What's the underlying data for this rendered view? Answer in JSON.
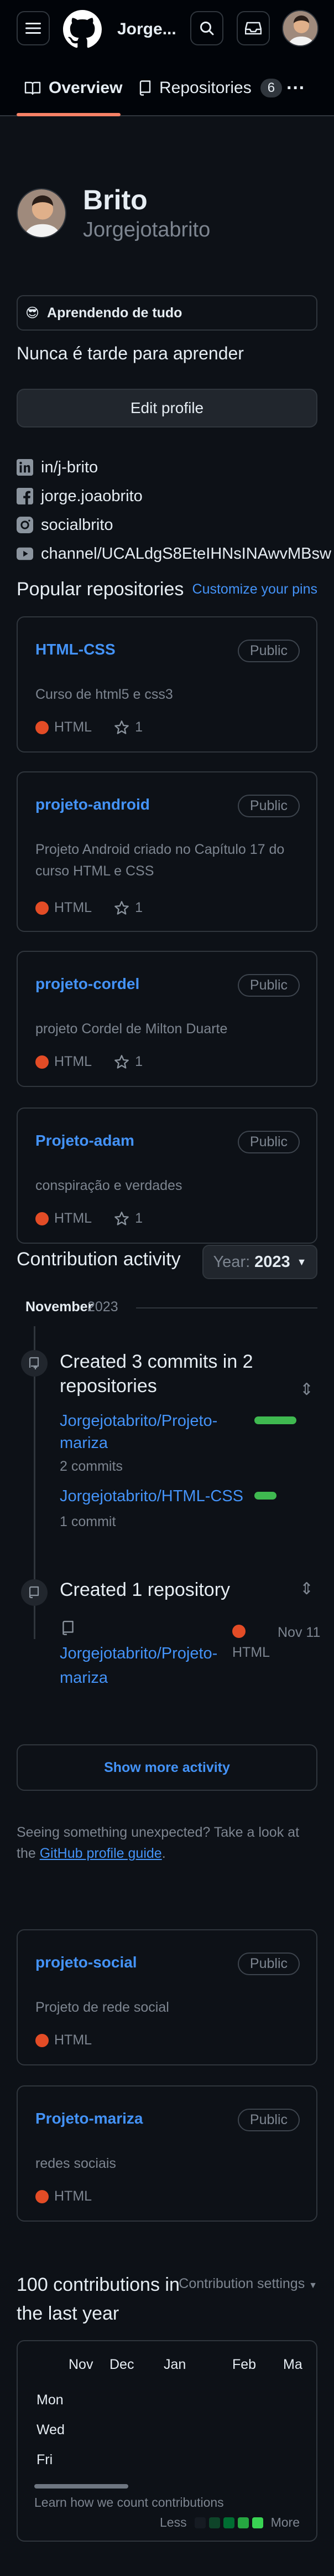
{
  "header": {
    "username": "Jorge...",
    "menu_icon": "hamburger-icon",
    "logo_icon": "github-logo",
    "search_icon": "search-icon",
    "inbox_icon": "inbox-icon"
  },
  "tabs": {
    "overview": "Overview",
    "repositories": "Repositories",
    "repo_count": "6",
    "more": "···"
  },
  "profile": {
    "name": "Brito",
    "login": "Jorgejotabrito",
    "status_emoji": "😎",
    "status_text": "Aprendendo de tudo",
    "bio": "Nunca é tarde para aprender",
    "edit_button": "Edit profile",
    "links": [
      {
        "icon": "linkedin-icon",
        "text": "in/j-brito"
      },
      {
        "icon": "facebook-icon",
        "text": "jorge.joaobrito"
      },
      {
        "icon": "instagram-icon",
        "text": "socialbrito"
      },
      {
        "icon": "youtube-icon",
        "text": "channel/UCALdgS8EteIHNsINAwvMBsw"
      }
    ]
  },
  "popular": {
    "title": "Popular repositories",
    "customize": "Customize your pins",
    "repos": [
      {
        "name": "HTML-CSS",
        "visibility": "Public",
        "description": "Curso de html5 e css3",
        "language": "HTML",
        "stars": "1"
      },
      {
        "name": "projeto-android",
        "visibility": "Public",
        "description": "Projeto Android criado no Capítulo 17 do curso HTML e CSS",
        "language": "HTML",
        "stars": "1"
      },
      {
        "name": "projeto-cordel",
        "visibility": "Public",
        "description": "projeto Cordel de Milton Duarte",
        "language": "HTML",
        "stars": "1"
      },
      {
        "name": "Projeto-adam",
        "visibility": "Public",
        "description": "conspiração e verdades",
        "language": "HTML",
        "stars": "1"
      }
    ]
  },
  "activity": {
    "title": "Contribution activity",
    "year_label": "Year:",
    "year_value": "2023",
    "month": "November",
    "month_year": "2023",
    "commits_title": "Created 3 commits in 2 repositories",
    "commit_repos": [
      {
        "name": "Jorgejotabrito/Projeto-mariza",
        "count": "2 commits",
        "bar": 0.85
      },
      {
        "name": "Jorgejotabrito/HTML-CSS",
        "count": "1 commit",
        "bar": 0.45
      }
    ],
    "created_title": "Created 1 repository",
    "created_repo": "Jorgejotabrito/Projeto-mariza",
    "created_lang": "HTML",
    "created_date": "Nov 11",
    "show_more": "Show more activity",
    "unexpected_text": "Seeing something unexpected? Take a look at the",
    "guide_link": "GitHub profile guide",
    "guide_period": "."
  },
  "extra_repos": [
    {
      "name": "projeto-social",
      "visibility": "Public",
      "description": "Projeto de rede social",
      "language": "HTML"
    },
    {
      "name": "Projeto-mariza",
      "visibility": "Public",
      "description": "redes sociais",
      "language": "HTML"
    }
  ],
  "contributions": {
    "title_line1": "100 contributions in",
    "title_line2": "the last year",
    "settings": "Contribution settings",
    "months": [
      "Nov",
      "Dec",
      "Jan",
      "Feb",
      "Ma"
    ],
    "days": [
      "Mon",
      "Wed",
      "Fri"
    ],
    "learn": "Learn how we count contributions",
    "less": "Less",
    "more": "More"
  },
  "colors": {
    "html_lang": "#e34c26",
    "link": "#4493f8",
    "green": "#3fb950",
    "accent_tab": "#f78166"
  }
}
